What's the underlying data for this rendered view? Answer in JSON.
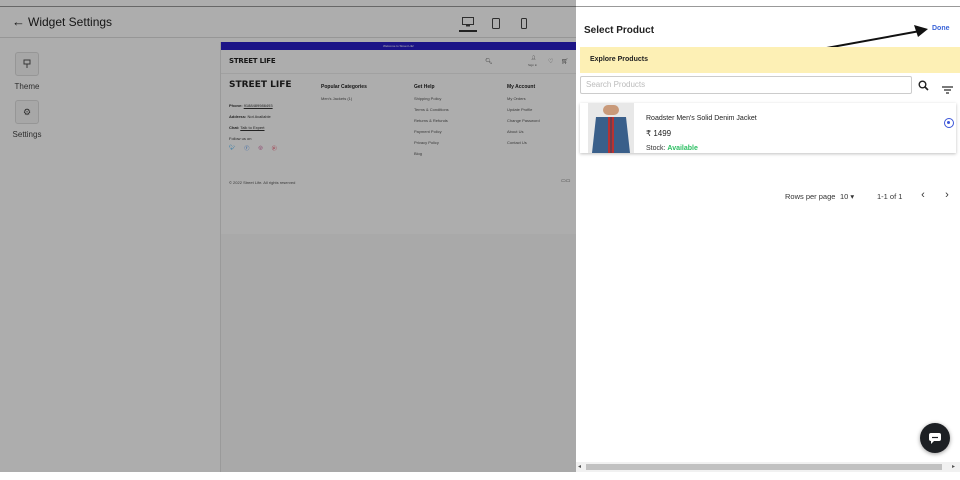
{
  "header": {
    "back_icon": "arrow-left-icon",
    "title": "Widget Settings"
  },
  "devices": [
    "desktop-icon",
    "tablet-icon",
    "mobile-icon"
  ],
  "sidebar": {
    "items": [
      {
        "label": "Theme",
        "icon": "theme-icon"
      },
      {
        "label": "Settings",
        "icon": "gear-icon"
      }
    ]
  },
  "preview": {
    "banner": "Welcome to Street Life!",
    "logo": "STREET LIFE",
    "signin": "Sign in",
    "footer": {
      "logo": "STREET LIFE",
      "phone_label": "Phone:",
      "phone": "9188489986493",
      "address_label": "Address:",
      "address": "Not Available",
      "chat_label": "Chat:",
      "chat": "Talk to Expert",
      "follow": "Follow us on",
      "popular_title": "Popular Categories",
      "popular": [
        "Men's Jackets (1)"
      ],
      "help_title": "Get Help",
      "help": [
        "Shipping Policy",
        "Terms & Conditions",
        "Returns & Refunds",
        "Payment Policy",
        "Privacy Policy",
        "Blog"
      ],
      "account_title": "My Account",
      "account": [
        "My Orders",
        "Update Profile",
        "Change Password",
        "About Us",
        "Contact Us"
      ],
      "copyright": "© 2022 Street Life. All rights reserved"
    }
  },
  "drawer": {
    "title": "Select Product",
    "done": "Done",
    "section": "Explore Products",
    "search_placeholder": "Search Products",
    "product": {
      "name": "Roadster Men's Solid Denim Jacket",
      "price": "₹ 1499",
      "stock_label": "Stock:",
      "stock_value": "Available",
      "selected": true
    },
    "pagination": {
      "rows_label": "Rows per page",
      "rows_value": "10",
      "range": "1-1 of 1"
    }
  },
  "colors": {
    "accent": "#3b64d8",
    "banner": "#2a1ec8",
    "highlight": "#fdf0b5",
    "available": "#2bbf62"
  }
}
